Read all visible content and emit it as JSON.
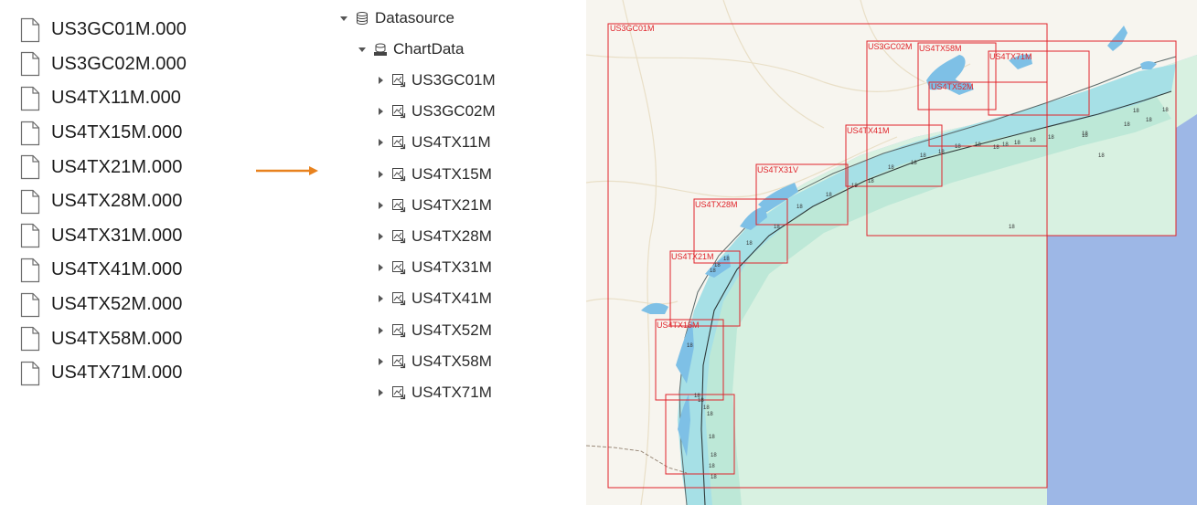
{
  "files": [
    {
      "name": "US3GC01M.000"
    },
    {
      "name": "US3GC02M.000"
    },
    {
      "name": "US4TX11M.000"
    },
    {
      "name": "US4TX15M.000"
    },
    {
      "name": "US4TX21M.000"
    },
    {
      "name": "US4TX28M.000"
    },
    {
      "name": "US4TX31M.000"
    },
    {
      "name": "US4TX41M.000"
    },
    {
      "name": "US4TX52M.000"
    },
    {
      "name": "US4TX58M.000"
    },
    {
      "name": "US4TX71M.000"
    }
  ],
  "file_icon": "document-icon",
  "arrow_color": "#e8821e",
  "tree": {
    "root": {
      "label": "Datasource",
      "icon": "database-icon"
    },
    "dataset": {
      "label": "ChartData",
      "icon": "s57-dataset-icon"
    },
    "children": [
      {
        "label": "US3GC01M"
      },
      {
        "label": "US3GC02M"
      },
      {
        "label": "US4TX11M"
      },
      {
        "label": "US4TX15M"
      },
      {
        "label": "US4TX21M"
      },
      {
        "label": "US4TX28M"
      },
      {
        "label": "US4TX31M"
      },
      {
        "label": "US4TX41M"
      },
      {
        "label": "US4TX52M"
      },
      {
        "label": "US4TX58M"
      },
      {
        "label": "US4TX71M"
      }
    ],
    "child_icon": "chart-layer-icon"
  },
  "map": {
    "cells": [
      {
        "label": "US3GC01M"
      },
      {
        "label": "US3GC02M"
      },
      {
        "label": "US4TX58M"
      },
      {
        "label": "US4TX71M"
      },
      {
        "label": "US4TX52M"
      },
      {
        "label": "US4TX41M"
      },
      {
        "label": "US4TX31V"
      },
      {
        "label": "US4TX28M"
      },
      {
        "label": "US4TX21M"
      },
      {
        "label": "US4TX15M"
      }
    ],
    "sounding_label": "18",
    "colors": {
      "land": "#f7f5ef",
      "water_deep": "#9db7e6",
      "shelf_light": "#d8f1e1",
      "shelf_mid": "#bde8d7",
      "near_shore": "#a6e0e6",
      "bay": "#7ec0e6",
      "cell_border": "#e0242b"
    }
  }
}
